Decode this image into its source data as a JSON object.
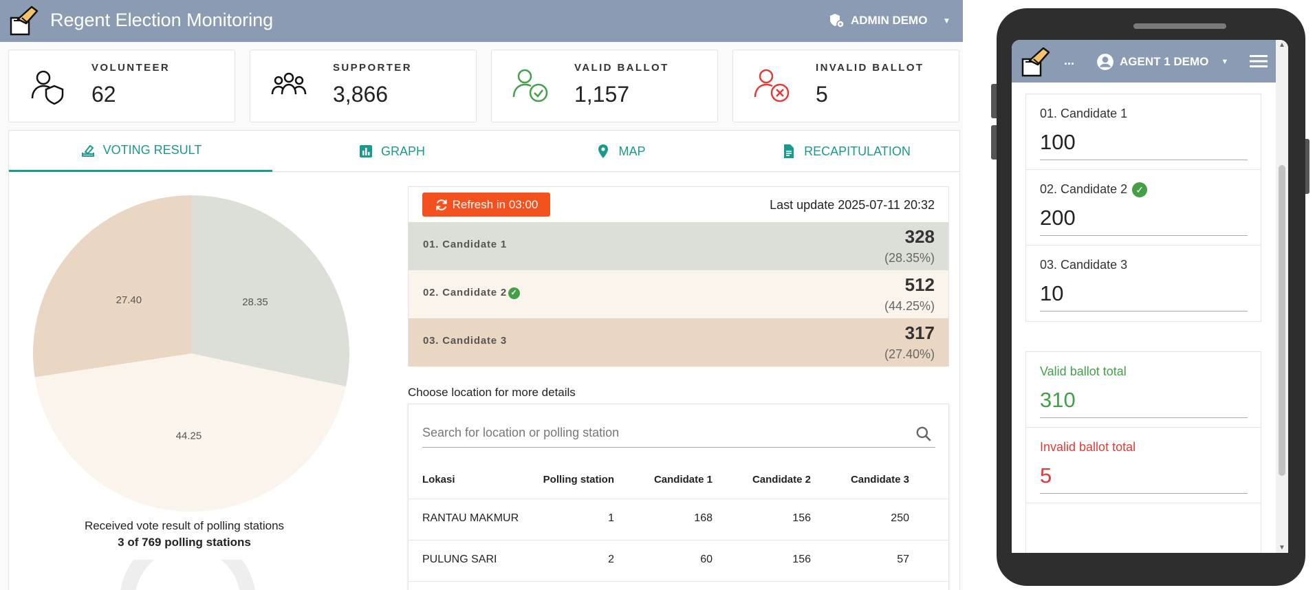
{
  "header": {
    "title": "Regent Election Monitoring",
    "user_name": "ADMIN DEMO"
  },
  "stats": [
    {
      "label": "VOLUNTEER",
      "value": "62",
      "icon": "volunteer-shield-icon"
    },
    {
      "label": "SUPPORTER",
      "value": "3,866",
      "icon": "group-icon"
    },
    {
      "label": "VALID BALLOT",
      "value": "1,157",
      "icon": "user-check-icon",
      "color": "#43a047"
    },
    {
      "label": "INVALID BALLOT",
      "value": "5",
      "icon": "user-x-icon",
      "color": "#e53935"
    }
  ],
  "tabs": [
    {
      "label": "VOTING RESULT",
      "icon": "ballot-icon"
    },
    {
      "label": "GRAPH",
      "icon": "bar-chart-icon"
    },
    {
      "label": "MAP",
      "icon": "map-pin-icon"
    },
    {
      "label": "RECAPITULATION",
      "icon": "document-icon"
    }
  ],
  "chart_data": {
    "type": "pie",
    "categories": [
      "01. Candidate 1",
      "02. Candidate 2",
      "03. Candidate 3"
    ],
    "values": [
      28.35,
      44.25,
      27.4
    ],
    "colors": [
      "#dcdfd8",
      "#fbf4ec",
      "#ead7c3"
    ]
  },
  "polling_summary": {
    "line1": "Received vote result of polling stations",
    "line2": "3 of 769 polling stations",
    "received": 3,
    "total": 769
  },
  "results": {
    "refresh_label": "Refresh in 03:00",
    "last_update": "Last update 2025-07-11 20:32",
    "candidates": [
      {
        "name": "01. Candidate 1",
        "votes": "328",
        "percent": "(28.35%)",
        "color": "#dcdfd8",
        "winner": false
      },
      {
        "name": "02. Candidate 2",
        "votes": "512",
        "percent": "(44.25%)",
        "color": "#fbf4ec",
        "winner": true
      },
      {
        "name": "03. Candidate 3",
        "votes": "317",
        "percent": "(27.40%)",
        "color": "#ead7c3",
        "winner": false
      }
    ]
  },
  "locations": {
    "heading": "Choose location for more details",
    "search_placeholder": "Search for location or polling station",
    "columns": [
      "Lokasi",
      "Polling station",
      "Candidate 1",
      "Candidate 2",
      "Candidate 3"
    ],
    "rows": [
      [
        "RANTAU MAKMUR",
        "1",
        "168",
        "156",
        "250"
      ],
      [
        "PULUNG SARI",
        "2",
        "60",
        "156",
        "57"
      ]
    ]
  },
  "mobile": {
    "header_dots": "...",
    "user_name": "AGENT 1 DEMO",
    "candidates": [
      {
        "label": "01. Candidate 1",
        "value": "100",
        "winner": false
      },
      {
        "label": "02. Candidate 2",
        "value": "200",
        "winner": true
      },
      {
        "label": "03. Candidate 3",
        "value": "10",
        "winner": false
      }
    ],
    "valid_label": "Valid ballot total",
    "valid_value": "310",
    "invalid_label": "Invalid ballot total",
    "invalid_value": "5",
    "colors": {
      "valid": "#43a047",
      "invalid": "#e53935"
    }
  }
}
